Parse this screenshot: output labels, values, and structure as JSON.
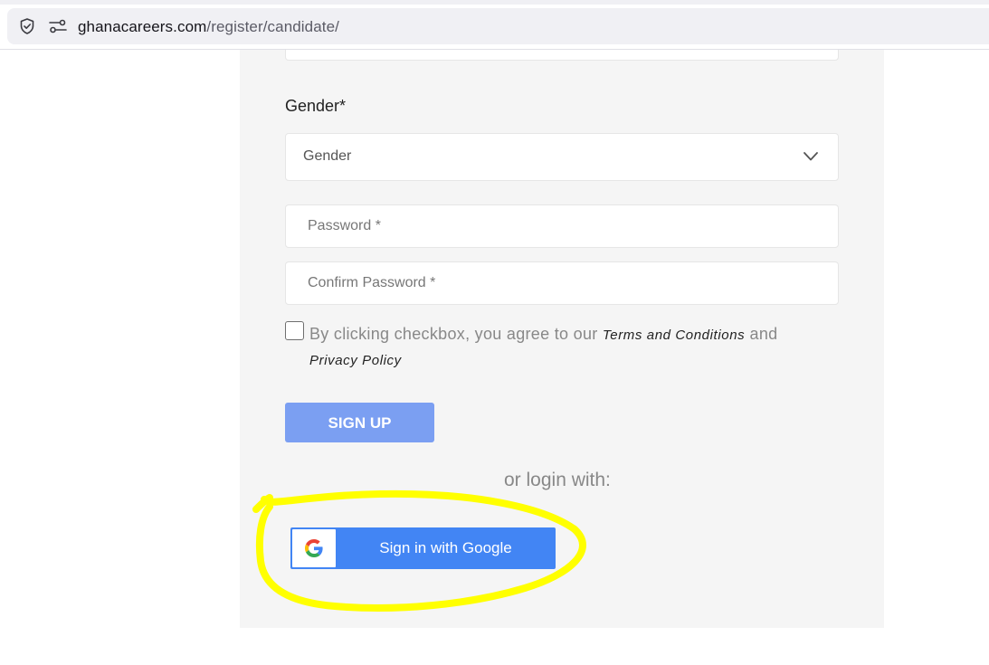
{
  "browser": {
    "url_domain": "ghanacareers.com",
    "url_path": "/register/candidate/"
  },
  "form": {
    "gender_label": "Gender*",
    "gender_select_value": "Gender",
    "password_placeholder": "Password *",
    "confirm_password_placeholder": "Confirm Password *",
    "terms_text_before": "By clicking checkbox, you agree to our ",
    "terms_link": "Terms and Conditions",
    "terms_text_and": " and ",
    "privacy_link": "Privacy Policy",
    "signup_label": "SIGN UP",
    "or_login_text": "or login with:",
    "google_button_label": "Sign in with Google"
  },
  "colors": {
    "signup_button": "#7b9ff2",
    "google_button": "#4285f4",
    "highlight": "#ffff00",
    "panel_background": "#f5f5f5"
  },
  "icons": [
    "shield-icon",
    "permissions-icon",
    "chevron-down-icon",
    "google-g-icon"
  ]
}
